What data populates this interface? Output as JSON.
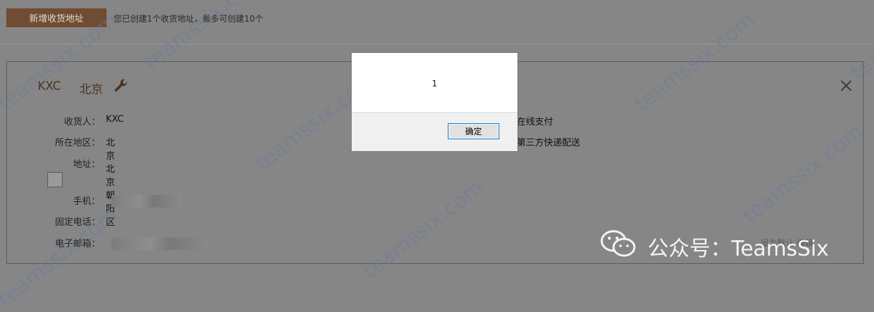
{
  "toolbar": {
    "add_address_label": "新增收货地址",
    "hint": "您已创建1个收货地址，最多可创建10个"
  },
  "card": {
    "name": "KXC",
    "city": "北京",
    "fields": [
      {
        "label": "收货人：",
        "value": "KXC"
      },
      {
        "label": "所在地区：",
        "value": "北京北京朝阳区"
      },
      {
        "label": "地址：",
        "value": ""
      },
      {
        "label": "手机：",
        "value": ""
      },
      {
        "label": "固定电话：",
        "value": ""
      },
      {
        "label": "电子邮箱：",
        "value": ""
      }
    ],
    "payment": "在线支付",
    "delivery": "第三方快递配送",
    "bottom_links": "设为默认  编辑"
  },
  "dialog": {
    "message": "1",
    "ok_label": "确定"
  },
  "watermark": {
    "text": "teamssix.com",
    "brand": "公众号：TeamsSix"
  },
  "colors": {
    "overlay": "#868686",
    "button_bg": "#6f4c32",
    "watermark": "#6a79a0",
    "dialog_focus": "#0078d7"
  }
}
